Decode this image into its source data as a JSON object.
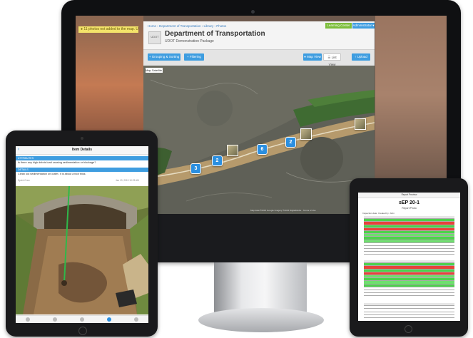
{
  "monitor": {
    "notification": "● 11 photos not added to the map. Undo",
    "app": {
      "breadcrumb": "Home  ›  Department of Transportation  ›  Library  ›  Photos",
      "learning_center_label": "Learning Center",
      "admin_label": "Administrator ▾",
      "logo_text": "UDOT",
      "title": "Department of Transportation",
      "subtitle": "UDOT Demonstration Package",
      "buttons": {
        "grouping": "+ Grouping & Sorting",
        "filtering": "+ Filtering",
        "map_view": "● Map View",
        "list_view": "☰ List View",
        "upload": "↑ Upload"
      },
      "map": {
        "toggle": "Map  Satellite",
        "pins": [
          "3",
          "2",
          "6",
          "2"
        ],
        "credit": "Map data ©2015 Google Imagery ©2015 DigitalGlobe · Terms of Use"
      }
    }
  },
  "tablet_left": {
    "header_title": "Item Details",
    "back_glyph": "‹",
    "sections": [
      {
        "label": "ATTRIBUTES",
        "row": "Is there any high debris load causing sedimentation or blockage?"
      },
      {
        "label": "DETAILS",
        "row": "Clean out sedimentation on outlet. It is about a foot thick."
      }
    ],
    "meta_left": "Sprint Crew",
    "meta_right": "Jan 13, 2015 10:23 AM"
  },
  "tablet_right": {
    "top_bar": "Report Preview",
    "title": "sEP 20-1",
    "subtitle": "Report Photo",
    "meta": "Inspection date:     Created by: John"
  }
}
